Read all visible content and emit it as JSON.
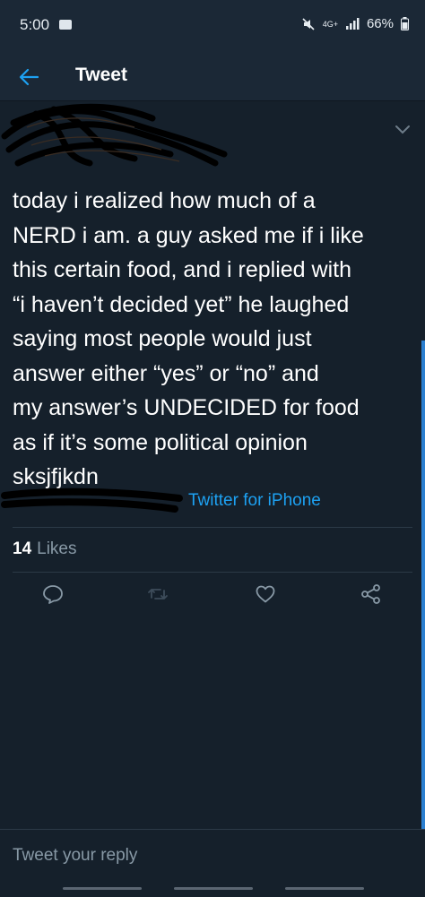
{
  "status_bar": {
    "time": "5:00",
    "network": "4G+",
    "battery": "66%"
  },
  "header": {
    "title": "Tweet"
  },
  "tweet": {
    "text": "today i realized how much of a\nNERD i am. a guy asked me if i like\nthis certain food, and i replied with\n“i haven’t decided yet” he laughed\nsaying most people would just\nanswer either “yes” or “no” and\nmy answer’s UNDECIDED for food\nas if it’s some political opinion\nsksjfjkdn",
    "source": "Twitter for iPhone",
    "likes_count": "14",
    "likes_label": "Likes"
  },
  "reply": {
    "placeholder": "Tweet your reply"
  },
  "colors": {
    "background": "#15202b",
    "accent": "#1da1f2",
    "muted": "#8899a6"
  },
  "icons": [
    "message-icon",
    "mute-icon",
    "signal-icon",
    "battery-icon",
    "back-arrow-icon",
    "chevron-down-icon",
    "reply-icon",
    "retweet-icon",
    "like-icon",
    "share-icon"
  ]
}
